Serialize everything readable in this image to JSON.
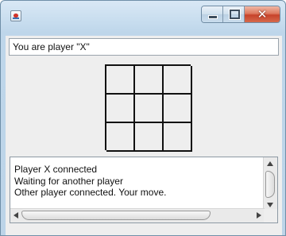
{
  "window": {
    "title": "",
    "controls": [
      "minimize-icon",
      "maximize-icon",
      "close-icon"
    ],
    "close_glyph": "✕"
  },
  "status": {
    "player_label": "You are player \"X\""
  },
  "board": {
    "cells": [
      "",
      "",
      "",
      "",
      "",
      "",
      "",
      "",
      ""
    ]
  },
  "log": {
    "lines": [
      "Player X connected",
      "Waiting for another player",
      "Other player connected. Your move."
    ]
  },
  "colors": {
    "close_button": "#c7432a",
    "titlebar": "#c6dcee",
    "panel": "#eeeeee"
  }
}
